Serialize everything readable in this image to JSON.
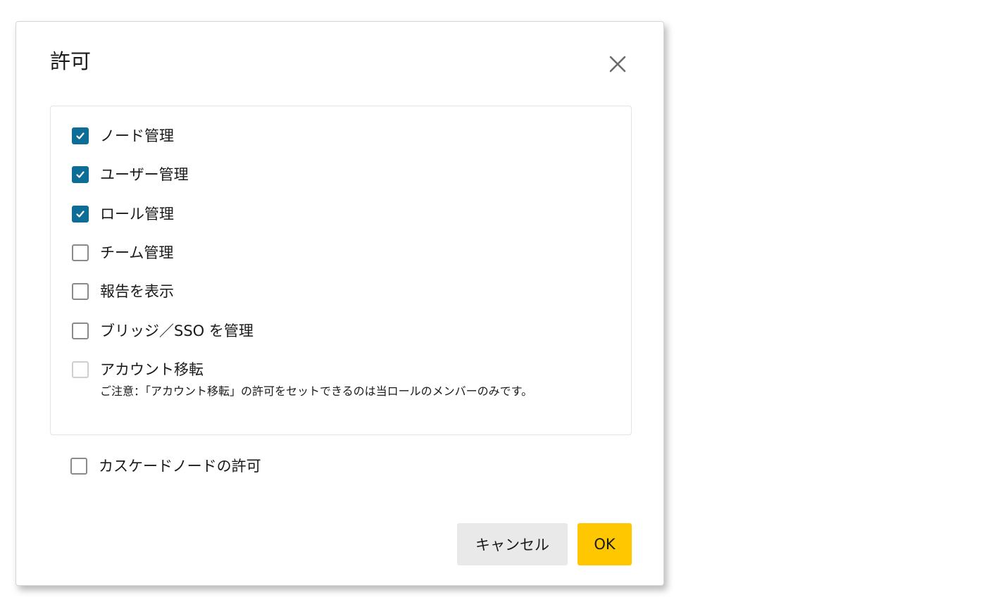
{
  "dialog": {
    "title": "許可",
    "close_icon": "close-icon"
  },
  "permissions": [
    {
      "label": "ノード管理",
      "checked": true,
      "disabled": false
    },
    {
      "label": "ユーザー管理",
      "checked": true,
      "disabled": false
    },
    {
      "label": "ロール管理",
      "checked": true,
      "disabled": false
    },
    {
      "label": "チーム管理",
      "checked": false,
      "disabled": false
    },
    {
      "label": "報告を表示",
      "checked": false,
      "disabled": false
    },
    {
      "label": "ブリッジ／SSO を管理",
      "checked": false,
      "disabled": false
    },
    {
      "label": "アカウント移転",
      "checked": false,
      "disabled": true
    }
  ],
  "account_transfer_note": "ご注意：「アカウント移転」の許可をセットできるのは当ロールのメンバーのみです。",
  "cascade": {
    "label": "カスケードノードの許可",
    "checked": false
  },
  "buttons": {
    "cancel_label": "キャンセル",
    "ok_label": "OK"
  },
  "colors": {
    "checkbox_checked": "#0e6d96",
    "ok_button": "#ffc700",
    "cancel_button": "#e9e9e9"
  }
}
